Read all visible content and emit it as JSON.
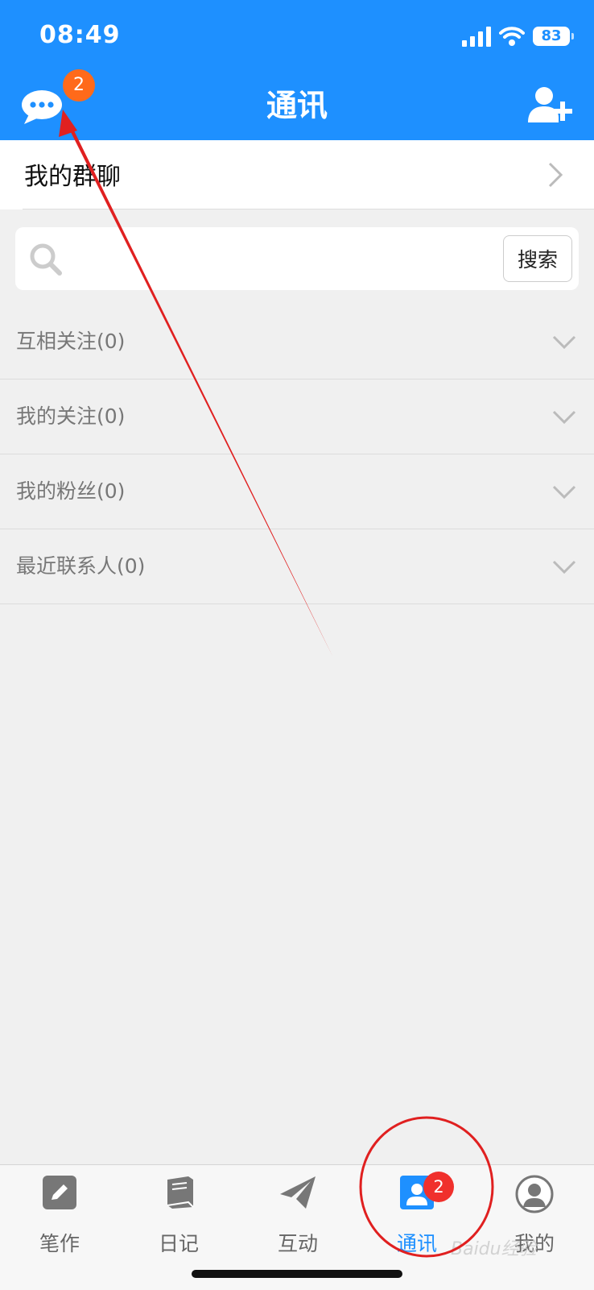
{
  "status_bar": {
    "time": "08:49",
    "battery": "83"
  },
  "header": {
    "title": "通讯",
    "message_badge": "2"
  },
  "group_chat": {
    "label": "我的群聊"
  },
  "search": {
    "placeholder": "",
    "button_label": "搜索"
  },
  "sections": [
    {
      "label": "互相关注(0)"
    },
    {
      "label": "我的关注(0)"
    },
    {
      "label": "我的粉丝(0)"
    },
    {
      "label": "最近联系人(0)"
    }
  ],
  "tab_bar": {
    "tabs": [
      {
        "label": "笔作",
        "icon": "pencil-icon"
      },
      {
        "label": "日记",
        "icon": "book-icon"
      },
      {
        "label": "互动",
        "icon": "paper-plane-icon"
      },
      {
        "label": "通讯",
        "icon": "contacts-icon",
        "badge": "2",
        "active": true
      },
      {
        "label": "我的",
        "icon": "profile-icon"
      }
    ]
  },
  "watermark": "Baidu经验",
  "colors": {
    "header": "#1e90ff",
    "badge_orange": "#ff6a1a",
    "badge_red": "#f0302c",
    "annotation_red": "#e02020"
  }
}
